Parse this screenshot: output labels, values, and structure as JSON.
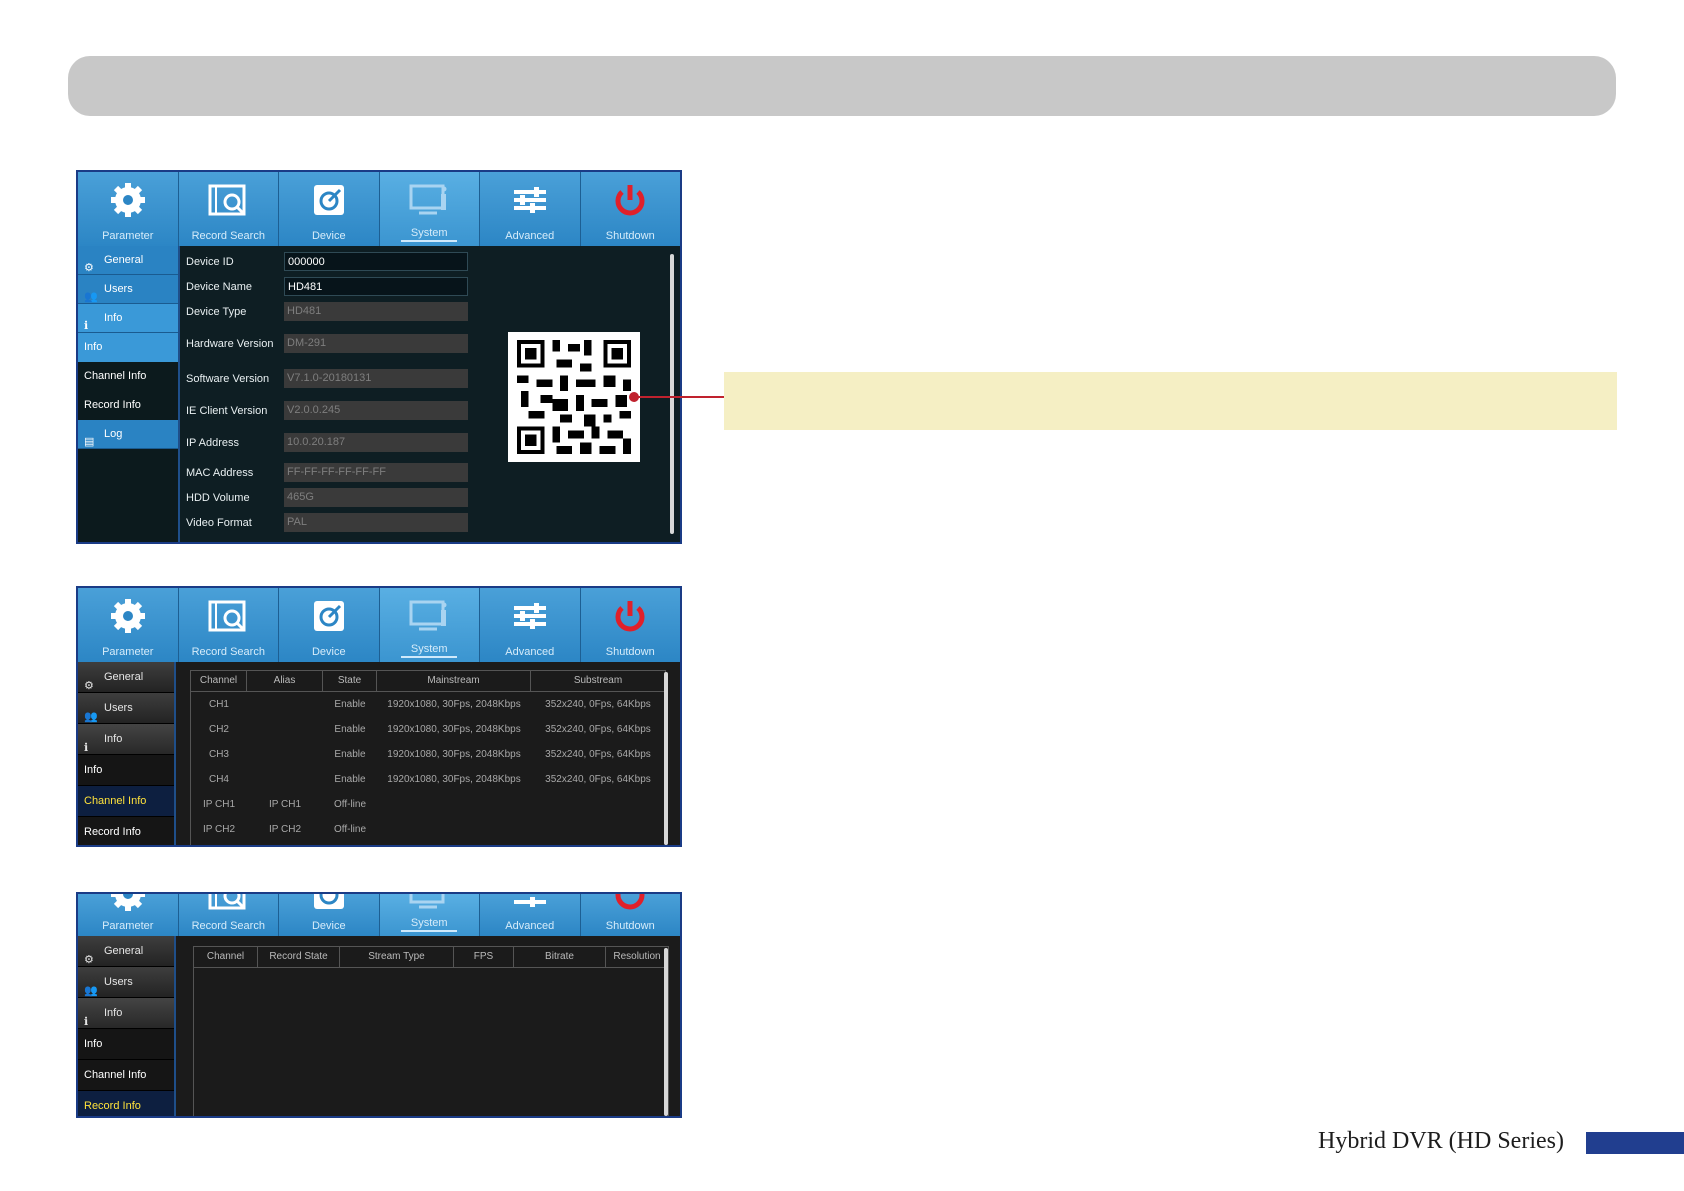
{
  "footer": {
    "title": "Hybrid DVR (HD Series)"
  },
  "colors": {
    "accent_blue": "#2c86c5",
    "header_bar": "#c8c8c8",
    "callout_fill": "#f5efc4",
    "callout_line": "#c0222e",
    "power_red": "#e0202a",
    "selected_text": "#ffe23b"
  },
  "topnav": [
    {
      "label": "Parameter",
      "icon": "gear-icon"
    },
    {
      "label": "Record Search",
      "icon": "film-search-icon"
    },
    {
      "label": "Device",
      "icon": "disk-icon"
    },
    {
      "label": "System",
      "icon": "monitor-info-icon"
    },
    {
      "label": "Advanced",
      "icon": "sliders-icon"
    },
    {
      "label": "Shutdown",
      "icon": "power-icon"
    }
  ],
  "sidebar": {
    "general": "General",
    "users": "Users",
    "info": "Info",
    "info_sub": "Info",
    "channel_info": "Channel Info",
    "record_info": "Record Info",
    "log": "Log"
  },
  "info_form": [
    {
      "label": "Device ID",
      "value": "000000"
    },
    {
      "label": "Device Name",
      "value": "HD481"
    },
    {
      "label": "Device Type",
      "value": "HD481"
    },
    {
      "label": "Hardware Version",
      "value": "DM-291"
    },
    {
      "label": "Software Version",
      "value": "V7.1.0-20180131"
    },
    {
      "label": "IE Client Version",
      "value": "V2.0.0.245"
    },
    {
      "label": "IP Address",
      "value": "10.0.20.187"
    },
    {
      "label": "MAC Address",
      "value": "FF-FF-FF-FF-FF-FF"
    },
    {
      "label": "HDD Volume",
      "value": "465G"
    },
    {
      "label": "Video Format",
      "value": "PAL"
    }
  ],
  "channel_table": {
    "headers": [
      "Channel",
      "Alias",
      "State",
      "Mainstream",
      "Substream"
    ],
    "rows": [
      [
        "CH1",
        "",
        "Enable",
        "1920x1080,   30Fps, 2048Kbps",
        "352x240,     0Fps, 64Kbps"
      ],
      [
        "CH2",
        "",
        "Enable",
        "1920x1080,   30Fps, 2048Kbps",
        "352x240,     0Fps, 64Kbps"
      ],
      [
        "CH3",
        "",
        "Enable",
        "1920x1080,   30Fps, 2048Kbps",
        "352x240,     0Fps, 64Kbps"
      ],
      [
        "CH4",
        "",
        "Enable",
        "1920x1080,   30Fps, 2048Kbps",
        "352x240,     0Fps, 64Kbps"
      ],
      [
        "IP CH1",
        "IP CH1",
        "Off-line",
        "",
        ""
      ],
      [
        "IP CH2",
        "IP CH2",
        "Off-line",
        "",
        ""
      ]
    ]
  },
  "record_table": {
    "headers": [
      "Channel",
      "Record State",
      "Stream Type",
      "FPS",
      "Bitrate",
      "Resolution"
    ]
  }
}
